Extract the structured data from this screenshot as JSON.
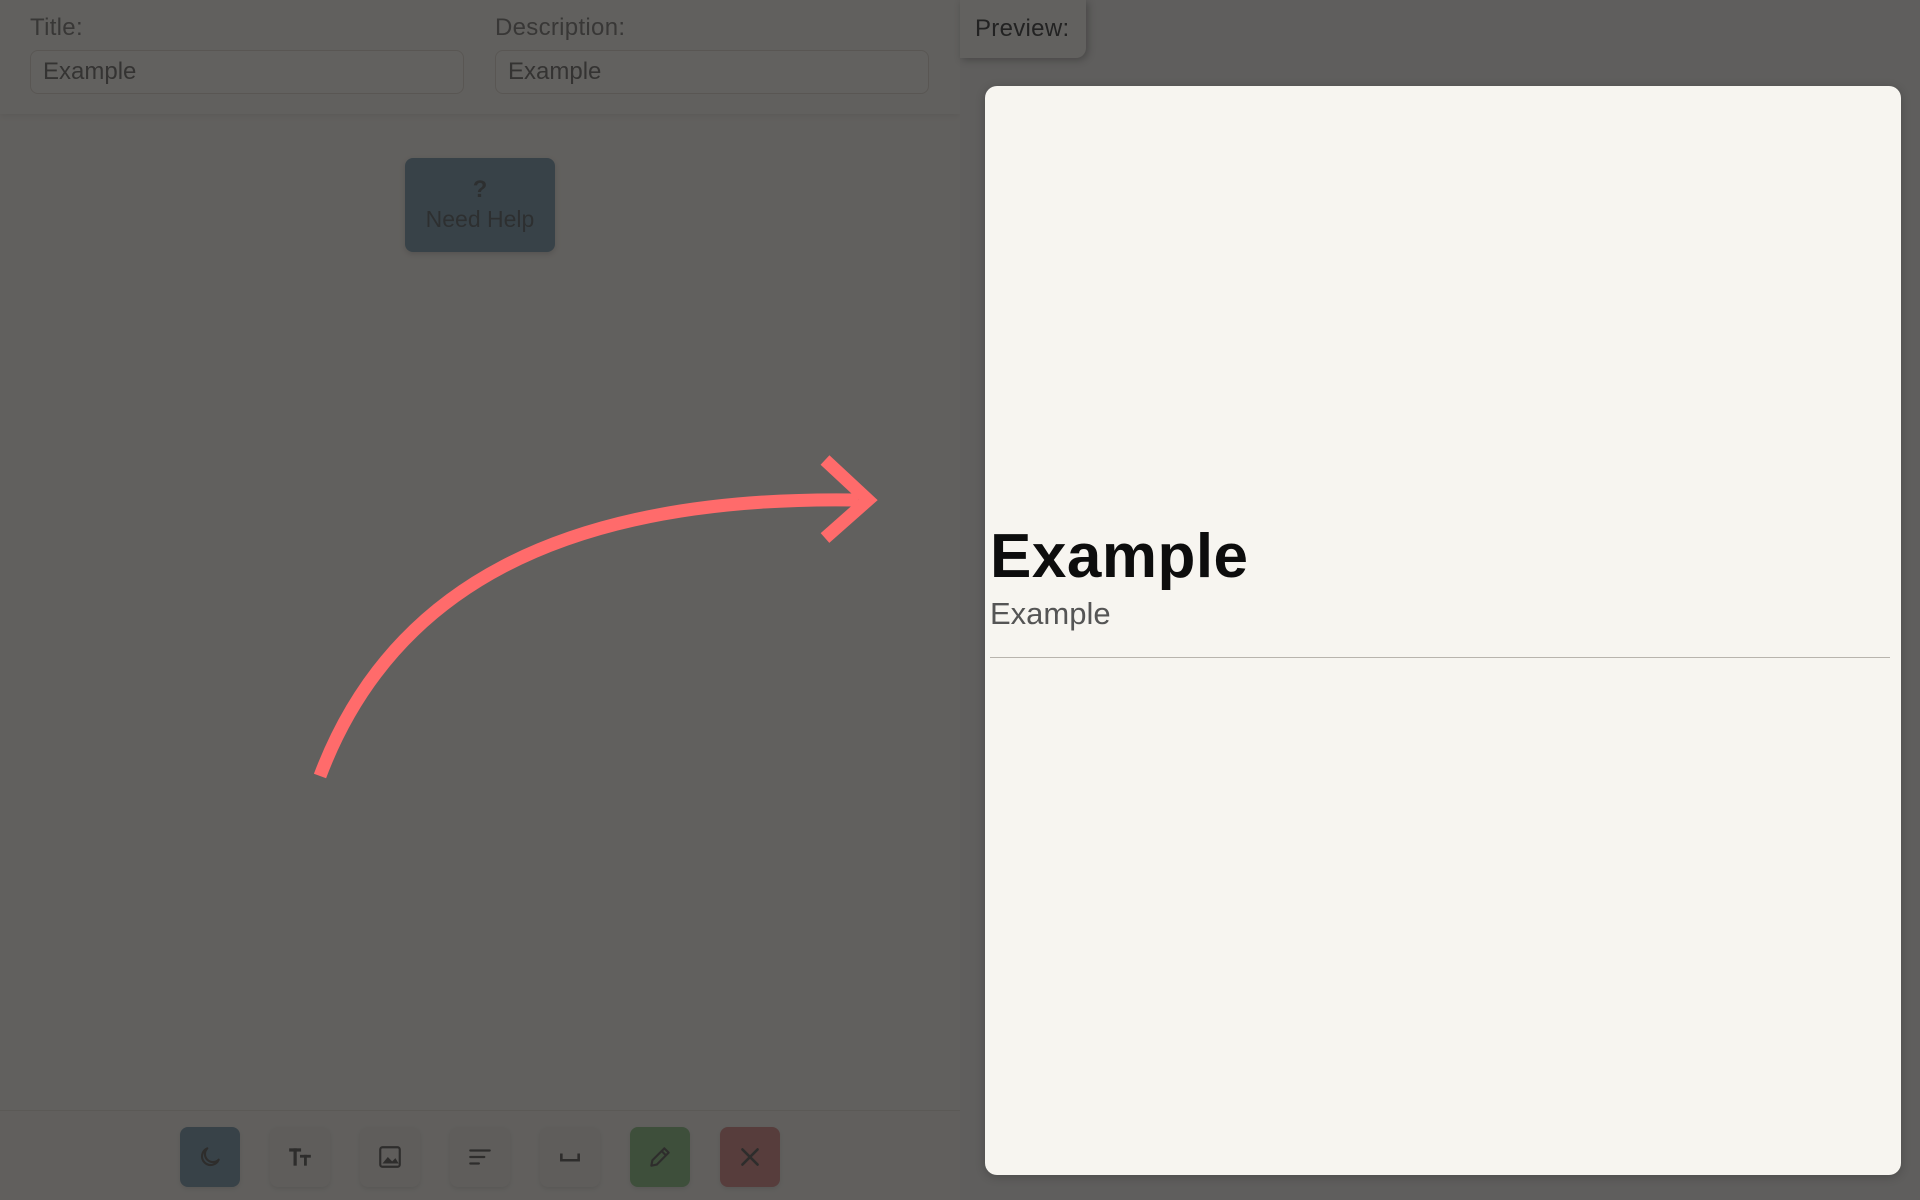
{
  "editor": {
    "title_field": {
      "label": "Title:",
      "value": "Example"
    },
    "description_field": {
      "label": "Description:",
      "value": "Example"
    },
    "help_button": {
      "icon_text": "?",
      "label": "Need Help"
    },
    "toolbar": {
      "buttons": [
        {
          "icon": "moon-icon"
        },
        {
          "icon": "text-size-icon"
        },
        {
          "icon": "image-icon"
        },
        {
          "icon": "align-left-icon"
        },
        {
          "icon": "spacer-icon"
        },
        {
          "icon": "pencil-icon"
        },
        {
          "icon": "close-icon"
        }
      ]
    }
  },
  "preview": {
    "tab_label": "Preview:",
    "title": "Example",
    "description": "Example"
  },
  "colors": {
    "overlay": "#5f5e5d",
    "accent_blue": "#3c6f8e",
    "accent_green": "#57a852",
    "accent_red": "#c85656",
    "arrow": "#ff6b6b",
    "card_bg": "#f7f5f0"
  }
}
